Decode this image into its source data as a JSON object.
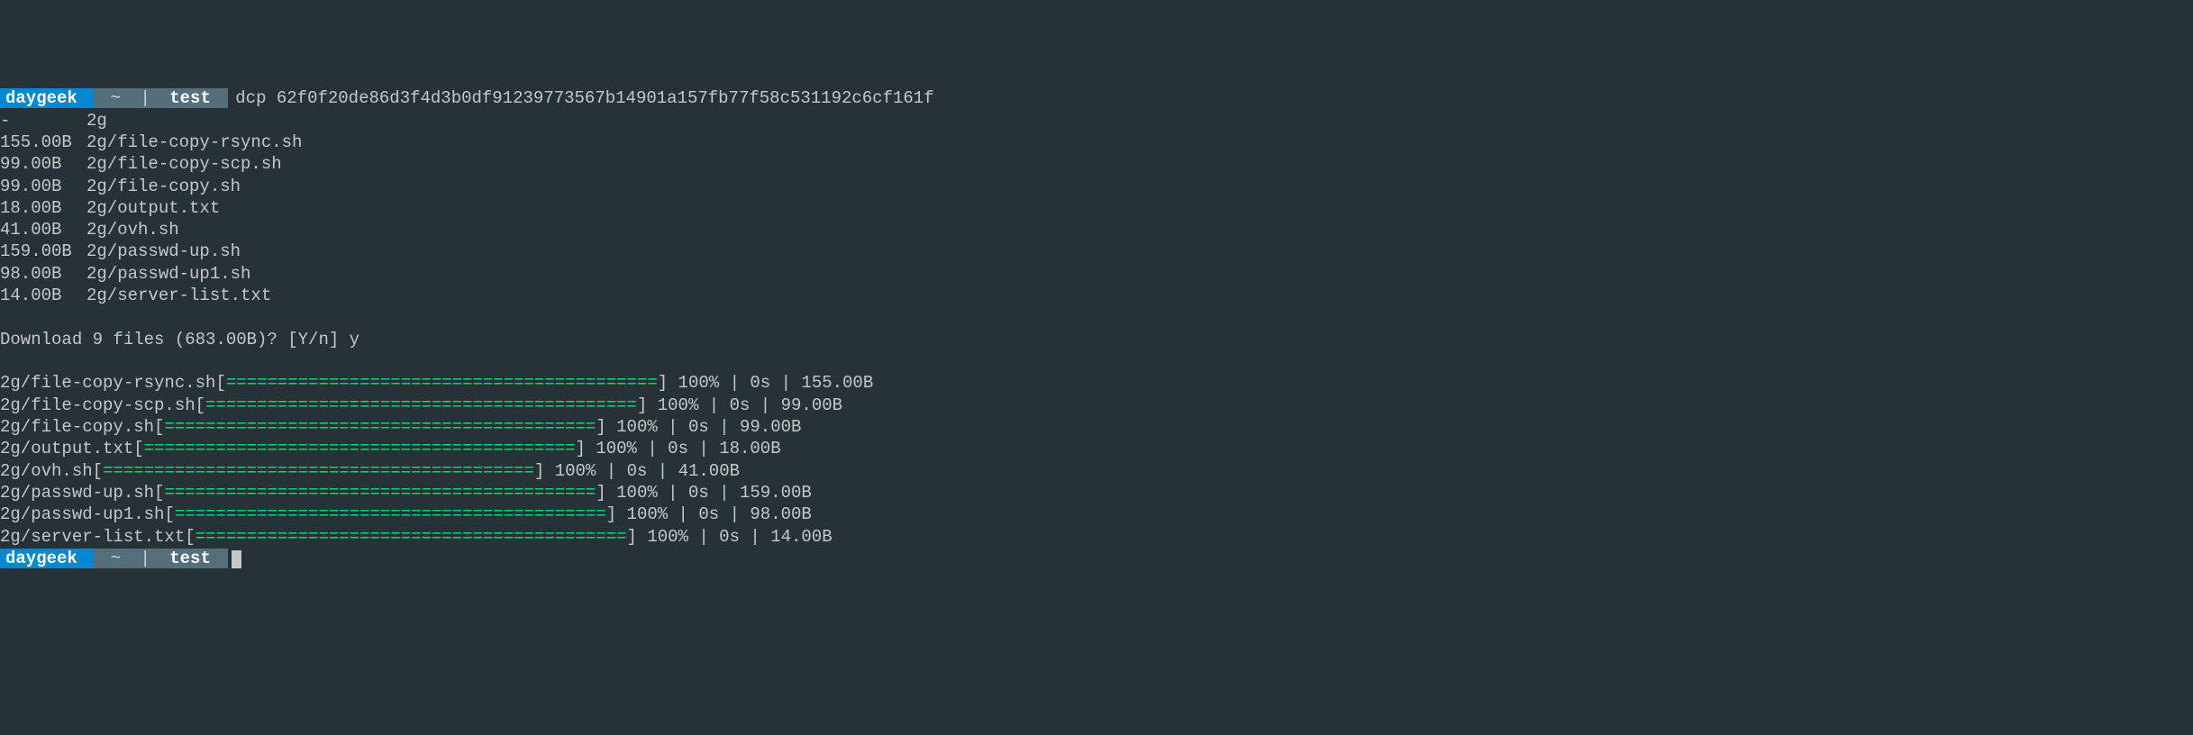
{
  "prompt": {
    "user": "daygeek",
    "tilde": "~",
    "sep": "|",
    "dir": "test"
  },
  "command": "dcp 62f0f20de86d3f4d3b0df91239773567b14901a157fb77f58c531192c6cf161f",
  "listing": [
    {
      "size": "-",
      "path": "2g"
    },
    {
      "size": "155.00B",
      "path": "2g/file-copy-rsync.sh"
    },
    {
      "size": "99.00B",
      "path": "2g/file-copy-scp.sh"
    },
    {
      "size": "99.00B",
      "path": "2g/file-copy.sh"
    },
    {
      "size": "18.00B",
      "path": "2g/output.txt"
    },
    {
      "size": "41.00B",
      "path": "2g/ovh.sh"
    },
    {
      "size": "159.00B",
      "path": "2g/passwd-up.sh"
    },
    {
      "size": "98.00B",
      "path": "2g/passwd-up1.sh"
    },
    {
      "size": "14.00B",
      "path": "2g/server-list.txt"
    }
  ],
  "confirm": "Download 9 files (683.00B)? [Y/n] y",
  "progress_bar": "==========================================",
  "downloads": [
    {
      "name": "2g/file-copy-rsync.sh",
      "pct": "100%",
      "time": "0s",
      "size": "155.00B"
    },
    {
      "name": "2g/file-copy-scp.sh",
      "pct": "100%",
      "time": "0s",
      "size": "99.00B"
    },
    {
      "name": "2g/file-copy.sh",
      "pct": "100%",
      "time": "0s",
      "size": "99.00B"
    },
    {
      "name": "2g/output.txt",
      "pct": "100%",
      "time": "0s",
      "size": "18.00B"
    },
    {
      "name": "2g/ovh.sh",
      "pct": "100%",
      "time": "0s",
      "size": "41.00B"
    },
    {
      "name": "2g/passwd-up.sh",
      "pct": "100%",
      "time": "0s",
      "size": "159.00B"
    },
    {
      "name": "2g/passwd-up1.sh",
      "pct": "100%",
      "time": "0s",
      "size": "98.00B"
    },
    {
      "name": "2g/server-list.txt",
      "pct": "100%",
      "time": "0s",
      "size": "14.00B"
    }
  ]
}
